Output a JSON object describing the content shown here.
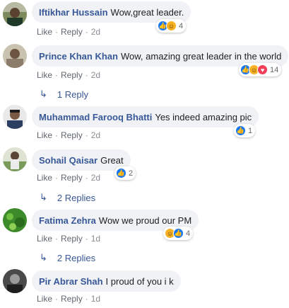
{
  "comments": [
    {
      "name": "Iftikhar Hussain",
      "text": "Wow,great leader.",
      "actions": [
        "Like",
        "Reply",
        "2d"
      ],
      "reactions_count": "4",
      "reactions": [
        "like-icon",
        "haha-icon"
      ]
    },
    {
      "name": "Prince Khan Khan",
      "text": "Wow, amazing great leader in the world",
      "actions": [
        "Like",
        "Reply",
        "2d"
      ],
      "reactions_count": "14",
      "reactions": [
        "like-icon",
        "haha-icon",
        "love-icon"
      ],
      "replies_label": "1 Reply"
    },
    {
      "name": "Muhammad Farooq Bhatti",
      "text": "Yes indeed amazing pic",
      "actions": [
        "Like",
        "Reply",
        "2d"
      ],
      "reactions_count": "1",
      "reactions": [
        "like-icon"
      ]
    },
    {
      "name": "Sohail Qaisar",
      "text": "Great",
      "actions": [
        "Like",
        "Reply",
        "2d"
      ],
      "reactions_count": "2",
      "reactions": [
        "like-icon"
      ],
      "replies_label": "2 Replies"
    },
    {
      "name": "Fatima Zehra",
      "text": "Wow we proud our PM",
      "actions": [
        "Like",
        "Reply",
        "1d"
      ],
      "reactions_count": "4",
      "reactions": [
        "haha-icon",
        "like-icon"
      ],
      "replies_label": "2 Replies"
    },
    {
      "name": "Pir Abrar Shah",
      "text": "I proud of you i k",
      "actions": [
        "Like",
        "Reply",
        "1d"
      ]
    }
  ],
  "colors": {
    "name": "#385898",
    "bubble": "#f0f2f5",
    "like": "#1877f2",
    "haha": "#f7b125",
    "love": "#f33e58"
  }
}
